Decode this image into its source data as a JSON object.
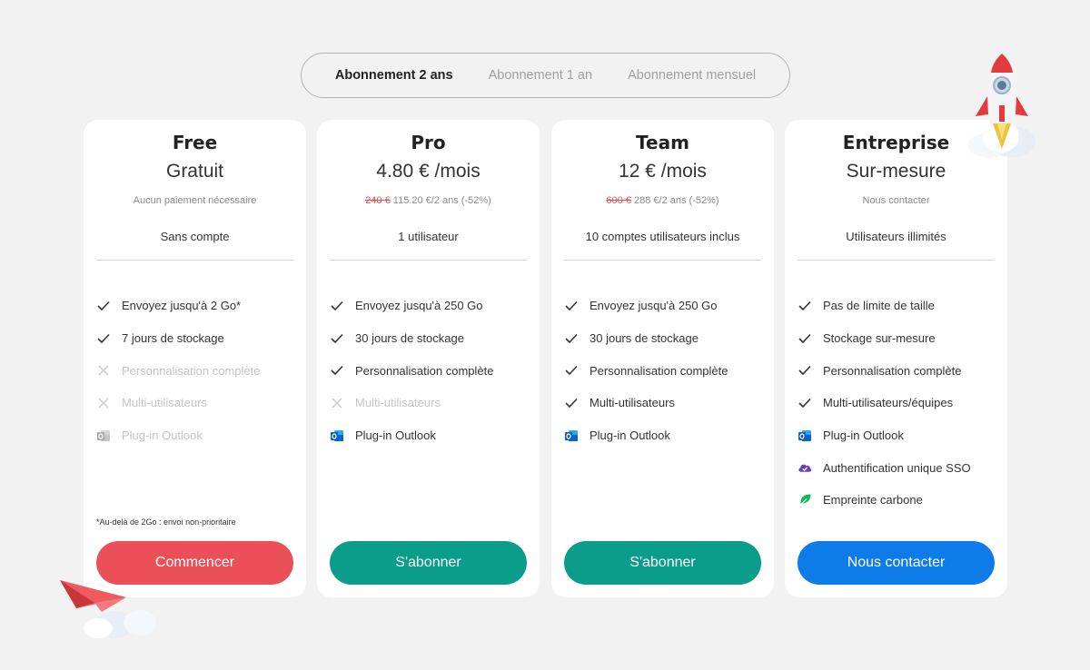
{
  "billing_toggle": {
    "options": [
      "Abonnement 2 ans",
      "Abonnement 1 an",
      "Abonnement mensuel"
    ],
    "selected": "Abonnement 2 ans"
  },
  "plans": [
    {
      "name": "Free",
      "price": "Gratuit",
      "sub_old": "",
      "sub": "Aucun paiement nécessaire",
      "users": "Sans compte",
      "features": [
        {
          "label": "Envoyez jusqu'à 2 Go*",
          "icon": "check-icon"
        },
        {
          "label": "7 jours de stockage",
          "icon": "check-icon"
        },
        {
          "label": "Personnalisation complète",
          "icon": "cross-icon"
        },
        {
          "label": "Multi-utilisateurs",
          "icon": "cross-icon"
        },
        {
          "label": "Plug-in Outlook",
          "icon": "outlook-icon-disabled"
        }
      ],
      "note": "*Au-delà de 2Go : envoi non-prioritaire",
      "cta": "Commencer",
      "cta_color": "#eb5058"
    },
    {
      "name": "Pro",
      "price": "4.80 € /mois",
      "sub_old": "240 €",
      "sub": " 115.20 €/2 ans (-52%)",
      "users": "1 utilisateur",
      "features": [
        {
          "label": "Envoyez jusqu'à 250 Go",
          "icon": "check-icon"
        },
        {
          "label": "30 jours de stockage",
          "icon": "check-icon"
        },
        {
          "label": "Personnalisation complète",
          "icon": "check-icon"
        },
        {
          "label": "Multi-utilisateurs",
          "icon": "cross-icon"
        },
        {
          "label": "Plug-in Outlook",
          "icon": "outlook-icon"
        }
      ],
      "note": "",
      "cta": "S'abonner",
      "cta_color": "#0a9e8a"
    },
    {
      "name": "Team",
      "price": "12 € /mois",
      "sub_old": "600 €",
      "sub": " 288 €/2 ans (-52%)",
      "users": "10 comptes utilisateurs inclus",
      "features": [
        {
          "label": "Envoyez jusqu'à 250 Go",
          "icon": "check-icon"
        },
        {
          "label": "30 jours de stockage",
          "icon": "check-icon"
        },
        {
          "label": "Personnalisation complète",
          "icon": "check-icon"
        },
        {
          "label": "Multi-utilisateurs",
          "icon": "check-icon"
        },
        {
          "label": "Plug-in Outlook",
          "icon": "outlook-icon"
        }
      ],
      "note": "",
      "cta": "S'abonner",
      "cta_color": "#0a9e8a"
    },
    {
      "name": "Entreprise",
      "price": "Sur-mesure",
      "sub_old": "",
      "sub": "Nous contacter",
      "users": "Utilisateurs illimités",
      "features": [
        {
          "label": "Pas de limite de taille",
          "icon": "check-icon"
        },
        {
          "label": "Stockage sur-mesure",
          "icon": "check-icon"
        },
        {
          "label": "Personnalisation complète",
          "icon": "check-icon"
        },
        {
          "label": "Multi-utilisateurs/équipes",
          "icon": "check-icon"
        },
        {
          "label": "Plug-in Outlook",
          "icon": "outlook-icon"
        },
        {
          "label": "Authentification unique SSO",
          "icon": "cloud-check-icon"
        },
        {
          "label": "Empreinte carbone",
          "icon": "leaf-icon"
        }
      ],
      "note": "",
      "cta": "Nous contacter",
      "cta_color": "#0d7ce9"
    }
  ],
  "decorations": [
    "rocket-illustration",
    "paper-plane-illustration"
  ]
}
